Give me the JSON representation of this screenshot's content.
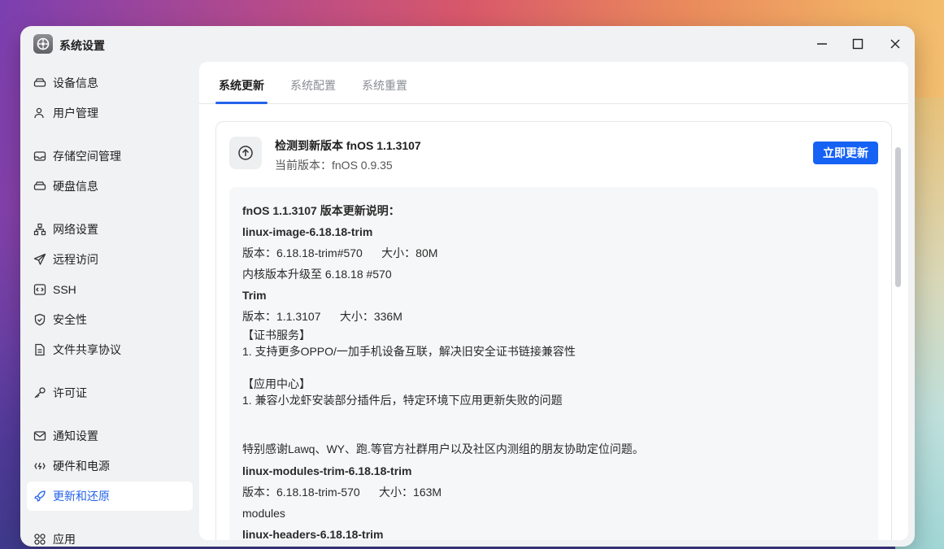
{
  "window": {
    "title": "系统设置"
  },
  "sidebar": {
    "items": [
      {
        "label": "设备信息",
        "icon": "device-icon"
      },
      {
        "label": "用户管理",
        "icon": "user-icon"
      },
      {
        "label": "存储空间管理",
        "icon": "storage-icon"
      },
      {
        "label": "硬盘信息",
        "icon": "disk-icon"
      },
      {
        "label": "网络设置",
        "icon": "network-icon"
      },
      {
        "label": "远程访问",
        "icon": "send-icon"
      },
      {
        "label": "SSH",
        "icon": "code-icon"
      },
      {
        "label": "安全性",
        "icon": "shield-icon"
      },
      {
        "label": "文件共享协议",
        "icon": "file-icon"
      },
      {
        "label": "许可证",
        "icon": "key-icon"
      },
      {
        "label": "通知设置",
        "icon": "mail-icon"
      },
      {
        "label": "硬件和电源",
        "icon": "power-icon"
      },
      {
        "label": "更新和还原",
        "icon": "rocket-icon",
        "active": true
      },
      {
        "label": "应用",
        "icon": "apps-icon"
      }
    ]
  },
  "tabs": [
    {
      "label": "系统更新",
      "active": true
    },
    {
      "label": "系统配置"
    },
    {
      "label": "系统重置"
    }
  ],
  "update": {
    "title": "检测到新版本 fnOS 1.1.3107",
    "current": "当前版本：fnOS 0.9.35",
    "button": "立即更新"
  },
  "notes": {
    "heading": "fnOS 1.1.3107 版本更新说明：",
    "pkg1_name": "linux-image-6.18.18-trim",
    "pkg1_meta": "版本：6.18.18-trim#570      大小：80M",
    "pkg1_desc": "内核版本升级至 6.18.18 #570",
    "pkg2_name": "Trim",
    "pkg2_meta": "版本：1.1.3107      大小：336M",
    "sec1_title": "【证书服务】",
    "sec1_item": "1. 支持更多OPPO/一加手机设备互联，解决旧安全证书链接兼容性",
    "sec2_title": "【应用中心】",
    "sec2_item": "1. 兼容小龙虾安装部分插件后，特定环境下应用更新失败的问题",
    "thanks": "特别感谢Lawq、WY、跑.等官方社群用户以及社区内测组的朋友协助定位问题。",
    "pkg3_name": "linux-modules-trim-6.18.18-trim",
    "pkg3_meta": "版本：6.18.18-trim-570      大小：163M",
    "pkg3_desc": "modules",
    "pkg4_name": "linux-headers-6.18.18-trim"
  },
  "colors": {
    "accent": "#1662f5",
    "active_text": "#2563eb"
  }
}
